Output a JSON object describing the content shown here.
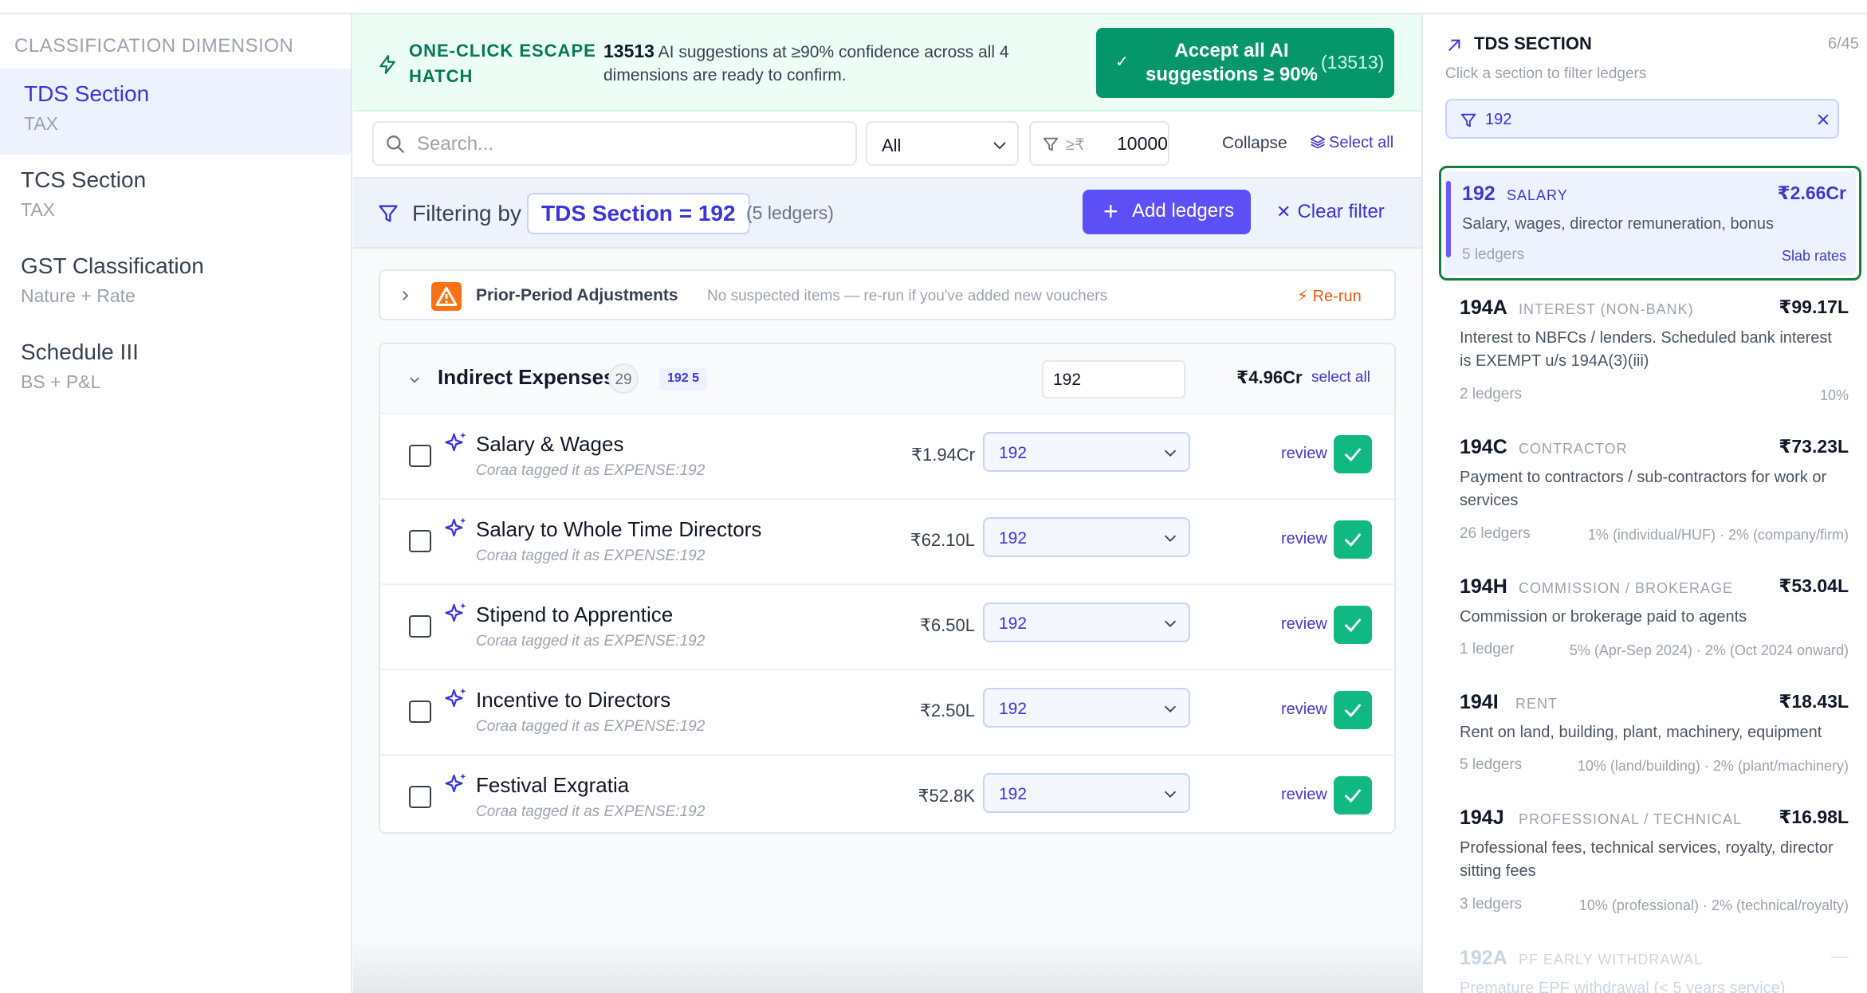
{
  "sidebar": {
    "heading": "CLASSIFICATION DIMENSION",
    "items": [
      {
        "name": "TDS Section",
        "sub": "TAX"
      },
      {
        "name": "TCS Section",
        "sub": "TAX"
      },
      {
        "name": "GST Classification",
        "sub": "Nature + Rate"
      },
      {
        "name": "Schedule III",
        "sub": "BS + P&L"
      }
    ]
  },
  "escape": {
    "title": "ONE-CLICK ESCAPE HATCH",
    "count": "13513",
    "desc": "AI suggestions at ≥90% confidence across all 4 dimensions are ready to confirm.",
    "button_label": "Accept all AI suggestions ≥ 90%",
    "button_count": "(13513)"
  },
  "toolbar": {
    "search_placeholder": "Search...",
    "scope": "All",
    "min_prefix": "≥₹",
    "min_value": "10000",
    "collapse": "Collapse",
    "select_all": "Select all"
  },
  "filter": {
    "label": "Filtering by",
    "chip": "TDS Section = 192",
    "count": "(5 ledgers)",
    "add_label": "Add ledgers",
    "clear_label": "Clear filter"
  },
  "prior": {
    "title": "Prior-Period Adjustments",
    "note": "No suspected items — re-run if you've added new vouchers",
    "rerun": "Re-run"
  },
  "group": {
    "title": "Indirect Expenses",
    "count": "29",
    "chip": "192 5",
    "input_value": "192",
    "total": "₹4.96Cr",
    "select_all": "select all",
    "rows": [
      {
        "name": "Salary & Wages",
        "tag": "Coraa tagged it as EXPENSE:192",
        "amount": "₹1.94Cr",
        "section": "192",
        "review": "review"
      },
      {
        "name": "Salary to Whole Time Directors",
        "tag": "Coraa tagged it as EXPENSE:192",
        "amount": "₹62.10L",
        "section": "192",
        "review": "review"
      },
      {
        "name": "Stipend to Apprentice",
        "tag": "Coraa tagged it as EXPENSE:192",
        "amount": "₹6.50L",
        "section": "192",
        "review": "review"
      },
      {
        "name": "Incentive to Directors",
        "tag": "Coraa tagged it as EXPENSE:192",
        "amount": "₹2.50L",
        "section": "192",
        "review": "review"
      },
      {
        "name": "Festival Exgratia",
        "tag": "Coraa tagged it as EXPENSE:192",
        "amount": "₹52.8K",
        "section": "192",
        "review": "review"
      }
    ]
  },
  "right": {
    "title": "TDS SECTION",
    "count": "6/45",
    "hint": "Click a section to filter ledgers",
    "filter_value": "192",
    "sections": [
      {
        "code": "192",
        "kind": "SALARY",
        "amount": "₹2.66Cr",
        "desc": "Salary, wages, director remuneration, bonus",
        "ledgers": "5 ledgers",
        "rate": "Slab rates"
      },
      {
        "code": "194A",
        "kind": "INTEREST (NON-BANK)",
        "amount": "₹99.17L",
        "desc": "Interest to NBFCs / lenders. Scheduled bank interest is EXEMPT u/s 194A(3)(iii)",
        "ledgers": "2 ledgers",
        "rate": "10%"
      },
      {
        "code": "194C",
        "kind": "CONTRACTOR",
        "amount": "₹73.23L",
        "desc": "Payment to contractors / sub-contractors for work or services",
        "ledgers": "26 ledgers",
        "rate": "1% (individual/HUF) · 2% (company/firm)"
      },
      {
        "code": "194H",
        "kind": "COMMISSION / BROKERAGE",
        "amount": "₹53.04L",
        "desc": "Commission or brokerage paid to agents",
        "ledgers": "1 ledger",
        "rate": "5% (Apr-Sep 2024) · 2% (Oct 2024 onward)"
      },
      {
        "code": "194I",
        "kind": "RENT",
        "amount": "₹18.43L",
        "desc": "Rent on land, building, plant, machinery, equipment",
        "ledgers": "5 ledgers",
        "rate": "10% (land/building) · 2% (plant/machinery)"
      },
      {
        "code": "194J",
        "kind": "PROFESSIONAL / TECHNICAL",
        "amount": "₹16.98L",
        "desc": "Professional fees, technical services, royalty, director sitting fees",
        "ledgers": "3 ledgers",
        "rate": "10% (professional) · 2% (technical/royalty)"
      },
      {
        "code": "192A",
        "kind": "PF EARLY WITHDRAWAL",
        "amount": "—",
        "desc": "Premature EPF withdrawal (< 5 years service)"
      }
    ]
  }
}
